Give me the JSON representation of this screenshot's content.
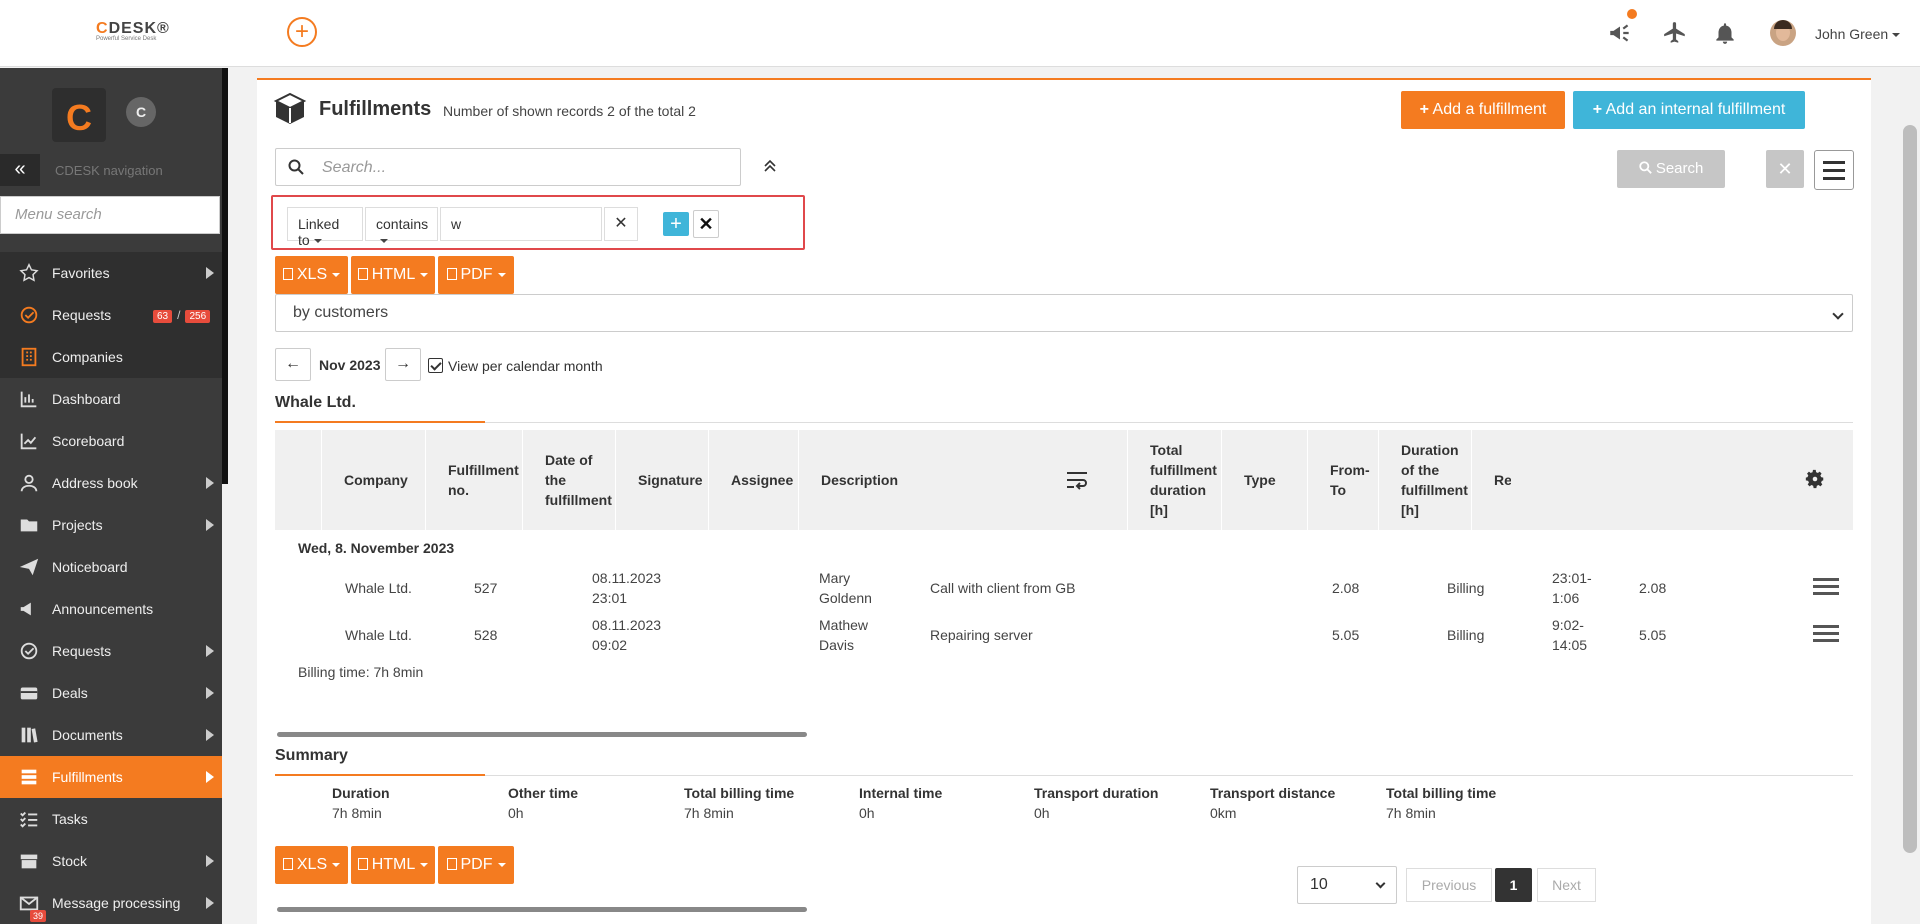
{
  "header": {
    "logo_text": "CDESK",
    "logo_tagline": "Powerful Service Desk",
    "user_name": "John Green"
  },
  "sidebar": {
    "brand_letter": "C",
    "brand_circle_letter": "C",
    "nav_label": "CDESK navigation",
    "menu_search_placeholder": "Menu search",
    "items": [
      {
        "label": "Favorites",
        "icon": "star-icon"
      },
      {
        "label": "Requests",
        "icon": "requests-icon",
        "badge_a": "63",
        "badge_sep": "/",
        "badge_b": "256"
      },
      {
        "label": "Companies",
        "icon": "building-icon"
      },
      {
        "label": "Dashboard",
        "icon": "dashboard-icon"
      },
      {
        "label": "Scoreboard",
        "icon": "chart-line-icon"
      },
      {
        "label": "Address book",
        "icon": "user-icon"
      },
      {
        "label": "Projects",
        "icon": "folder-icon"
      },
      {
        "label": "Noticeboard",
        "icon": "paper-plane-icon"
      },
      {
        "label": "Announcements",
        "icon": "megaphone-icon"
      },
      {
        "label": "Requests",
        "icon": "requests-icon"
      },
      {
        "label": "Deals",
        "icon": "deals-icon"
      },
      {
        "label": "Documents",
        "icon": "documents-icon"
      },
      {
        "label": "Fulfillments",
        "icon": "fulfillments-icon"
      },
      {
        "label": "Tasks",
        "icon": "tasks-icon"
      },
      {
        "label": "Stock",
        "icon": "stock-icon"
      },
      {
        "label": "Message processing",
        "icon": "mail-icon",
        "badge": "39"
      }
    ]
  },
  "page": {
    "title": "Fulfillments",
    "subtitle": "Number of shown records 2 of the total 2",
    "add_button": "Add a fulfillment",
    "add_internal_button": "Add an internal fulfillment",
    "search_placeholder": "Search...",
    "search_button": "Search"
  },
  "filter": {
    "field": "Linked to",
    "operator": "contains",
    "value": "w"
  },
  "export": {
    "xls": "XLS",
    "html": "HTML",
    "pdf": "PDF"
  },
  "grouping": {
    "selected": "by customers"
  },
  "period": {
    "month": "Nov 2023",
    "per_month_label": "View per calendar month"
  },
  "group": {
    "name": "Whale Ltd."
  },
  "table": {
    "columns": [
      "Company",
      "Fulfillment no.",
      "Date of the fulfillment",
      "Signature",
      "Assignee",
      "Description",
      "Total fulfillment duration [h]",
      "Type",
      "From-To",
      "Duration of the fulfillment [h]",
      "Rec"
    ],
    "day": "Wed, 8. November 2023",
    "rows": [
      {
        "company": "Whale Ltd.",
        "no": "527",
        "date": "08.11.2023 23:01",
        "signature": "",
        "assignee": "Mary Goldenn",
        "description": "Call with client from GB",
        "total": "2.08",
        "type": "Billing",
        "from_to": "23:01-1:06",
        "duration": "2.08"
      },
      {
        "company": "Whale Ltd.",
        "no": "528",
        "date": "08.11.2023 09:02",
        "signature": "",
        "assignee": "Mathew Davis",
        "description": "Repairing server",
        "total": "5.05",
        "type": "Billing",
        "from_to": "9:02-14:05",
        "duration": "5.05"
      }
    ],
    "billing_time": "Billing time: 7h 8min"
  },
  "summary": {
    "title": "Summary",
    "items": [
      {
        "label": "Duration",
        "value": "7h 8min"
      },
      {
        "label": "Other time",
        "value": "0h"
      },
      {
        "label": "Total billing time",
        "value": "7h 8min"
      },
      {
        "label": "Internal time",
        "value": "0h"
      },
      {
        "label": "Transport duration",
        "value": "0h"
      },
      {
        "label": "Transport distance",
        "value": "0km"
      },
      {
        "label": "Total billing time",
        "value": "7h 8min"
      }
    ]
  },
  "pagination": {
    "page_size": "10",
    "previous": "Previous",
    "current": "1",
    "next": "Next"
  },
  "colors": {
    "accent": "#f47b20",
    "info": "#3fb5d9",
    "sidebar_bg": "#3b3b3b",
    "highlight_border": "#e0484b"
  }
}
